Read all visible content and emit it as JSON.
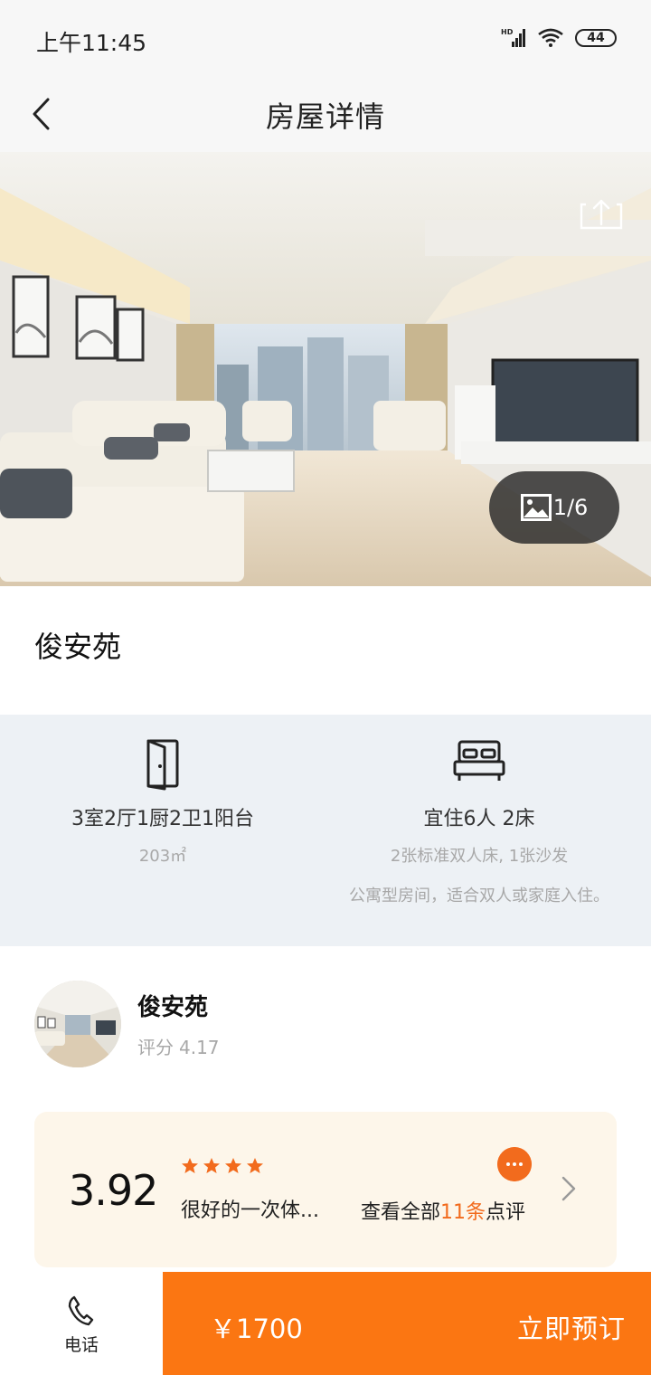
{
  "status_bar": {
    "time": "上午11:45",
    "signal_label": "HD",
    "battery": "44"
  },
  "nav": {
    "title": "房屋详情",
    "back_icon": "chevron-left-icon"
  },
  "gallery": {
    "counter": "1/6",
    "share_icon": "share-icon",
    "gallery_icon": "image-icon"
  },
  "listing": {
    "title": "俊安苑"
  },
  "info": {
    "layout": "3室2厅1厨2卫1阳台",
    "area": "203㎡",
    "guests": "宜住6人 2床",
    "beds": "2张标准双人床, 1张沙发",
    "description": "公寓型房间，适合双人或家庭入住。"
  },
  "host": {
    "name": "俊安苑",
    "rating_label": "评分",
    "rating_value": "4.17"
  },
  "review": {
    "score": "3.92",
    "stars": 4,
    "snippet": "很好的一次体...",
    "all_prefix": "查看全部",
    "count": "11条",
    "all_suffix": "点评"
  },
  "bottom": {
    "phone_label": "电话",
    "price": "￥1700",
    "book_label": "立即预订"
  },
  "colors": {
    "accent": "#fb7612",
    "accent_text": "#f26b1d",
    "info_panel_bg": "#edf1f5",
    "review_card_bg": "#fdf6ea"
  }
}
